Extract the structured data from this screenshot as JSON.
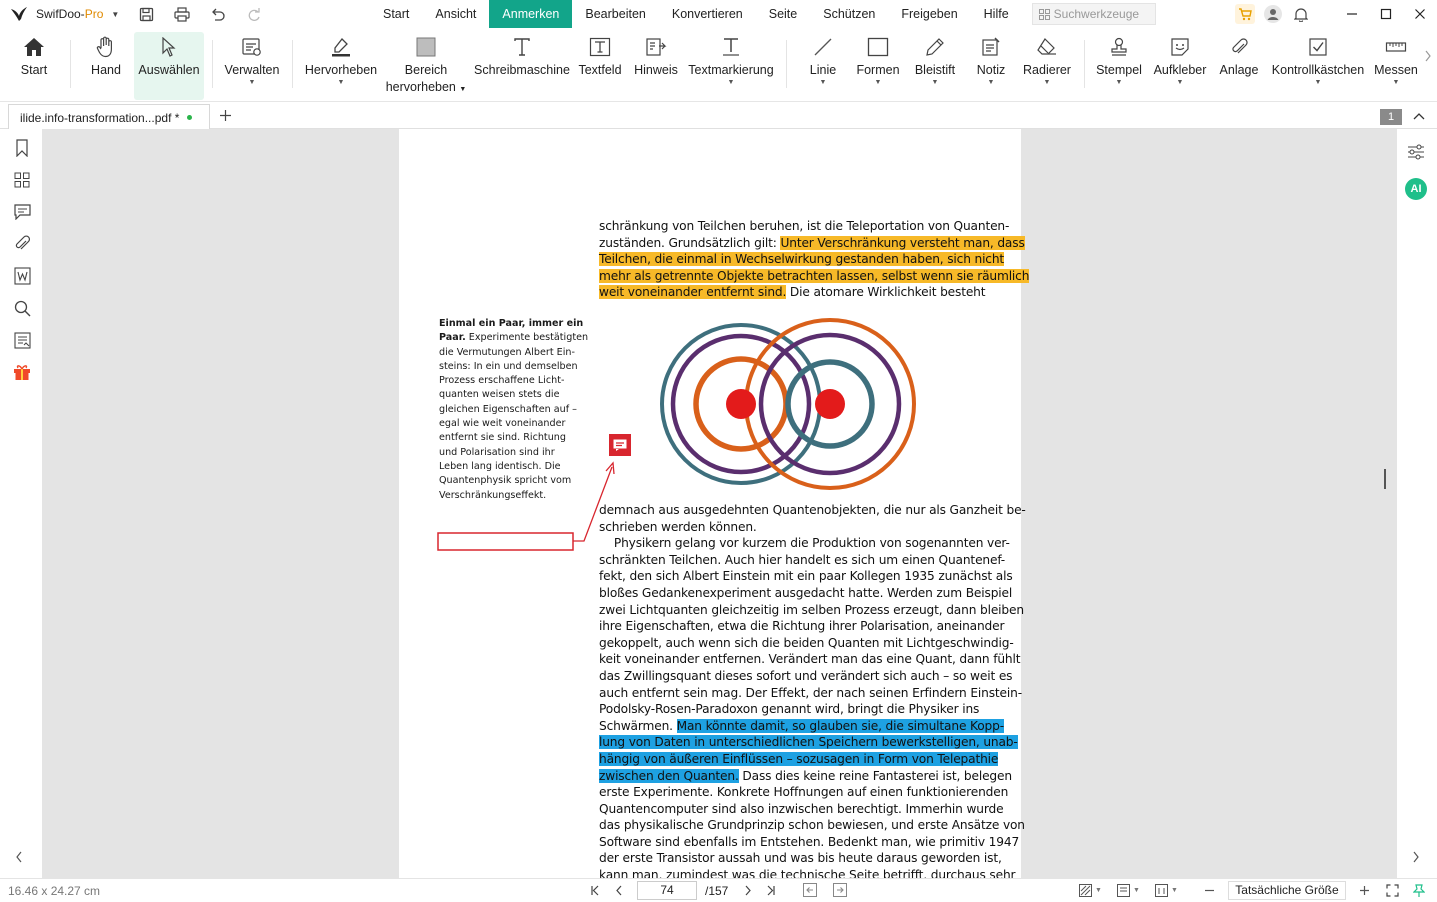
{
  "app": {
    "name": "SwifDoo-",
    "edition": "Pro"
  },
  "menu": {
    "items": [
      "Start",
      "Ansicht",
      "Anmerken",
      "Bearbeiten",
      "Konvertieren",
      "Seite",
      "Schützen",
      "Freigeben",
      "Hilfe"
    ],
    "active_index": 2,
    "search_placeholder": "Suchwerkzeuge"
  },
  "ribbon": {
    "start": "Start",
    "hand": "Hand",
    "select": "Auswählen",
    "manage": "Verwalten",
    "highlight": "Hervorheben",
    "area_1": "Bereich",
    "area_2": "hervorheben",
    "typewriter": "Schreibmaschine",
    "textfield": "Textfeld",
    "hint": "Hinweis",
    "textmark": "Textmarkierung",
    "line": "Linie",
    "shapes": "Formen",
    "pencil": "Bleistift",
    "note": "Notiz",
    "eraser": "Radierer",
    "stamp": "Stempel",
    "sticker": "Aufkleber",
    "attachment": "Anlage",
    "checkbox": "Kontrollkästchen",
    "measure": "Messen"
  },
  "tab": {
    "filename": "ilide.info-transformation...pdf *",
    "page_badge": "1"
  },
  "document": {
    "top_lines": [
      "schränkung von Teilchen beruhen, ist die Teleportation von Quanten-",
      "zuständen. Grundsätzlich gilt: ",
      "Unter Verschränkung versteht man, dass",
      "Teilchen, die einmal in Wechselwirkung gestanden haben, sich nicht",
      "mehr als getrennte Objekte betrachten lassen, selbst wenn sie räumlich",
      "weit voneinander entfernt sind.",
      " Die atomare Wirklichkeit besteht"
    ],
    "caption_bold": "Einmal ein Paar, immer ein",
    "caption_lines": [
      "Paar.",
      " Experimente bestätigten",
      "die Vermutungen Albert Ein-",
      "steins: In ein und demselben",
      "Prozess erschaffene Licht-",
      "quanten weisen stets die",
      "gleichen Eigenschaften auf –",
      "egal wie weit voneinander",
      "entfernt sie sind. Richtung",
      "und Polarisation sind ihr",
      "Leben lang identisch. Die",
      "Quantenphysik spricht vom",
      "Verschränkungseffekt."
    ],
    "body_lines": [
      "demnach aus ausgedehnten Quantenobjekten, die nur als Ganzheit be-",
      "schrieben werden können.",
      "    Physikern gelang vor kurzem die Produktion von sogenannten ver-",
      "schränkten Teilchen. Auch hier handelt es sich um einen Quantenef-",
      "fekt, den sich Albert Einstein mit ein paar Kollegen 1935 zunächst als",
      "bloßes Gedankenexperiment ausgedacht hatte. Werden zum Beispiel",
      "zwei Lichtquanten gleichzeitig im selben Prozess erzeugt, dann bleiben",
      "ihre Eigenschaften, etwa die Richtung ihrer Polarisation, aneinander",
      "gekoppelt, auch wenn sich die beiden Quanten mit Lichtgeschwindig-",
      "keit voneinander entfernen. Verändert man das eine Quant, dann fühlt",
      "das Zwillingsquant dieses sofort und verändert sich auch – so weit es",
      "auch entfernt sein mag. Der Effekt, der nach seinen Erfindern Einstein-",
      "Podolsky-Rosen-Paradoxon genannt wird, bringt die Physiker ins",
      "Schwärmen. ",
      "Man könnte damit, so glauben sie, die simultane Kopp-",
      "lung von Daten in unterschiedlichen Speichern bewerkstelligen, unab-",
      "hängig von äußeren Einflüssen – sozusagen in Form von Telepathie",
      "zwischen den Quanten.",
      " Dass dies keine reine Fantasterei ist, belegen",
      "erste Experimente. Konkrete Hoffnungen auf einen funktionierenden",
      "Quantencomputer sind also inzwischen berechtigt. Immerhin wurde",
      "das physikalische Grundprinzip schon bewiesen, und erste Ansätze von",
      "Software sind ebenfalls im Entstehen. Bedenkt man, wie primitiv 1947",
      "der erste Transistor aussah und was bis heute daraus geworden ist,",
      "kann man, zumindest was die technische Seite betrifft, durchaus sehr"
    ]
  },
  "status": {
    "page_size": "16.46 x 24.27 cm",
    "current_page": "74",
    "total_pages": "/157",
    "zoom_label": "Tatsächliche Größe"
  },
  "colors": {
    "accent": "#12a58a",
    "highlight_yellow": "#f7b928",
    "highlight_blue": "#1ea1e2",
    "annotation_red": "#d8262e"
  }
}
